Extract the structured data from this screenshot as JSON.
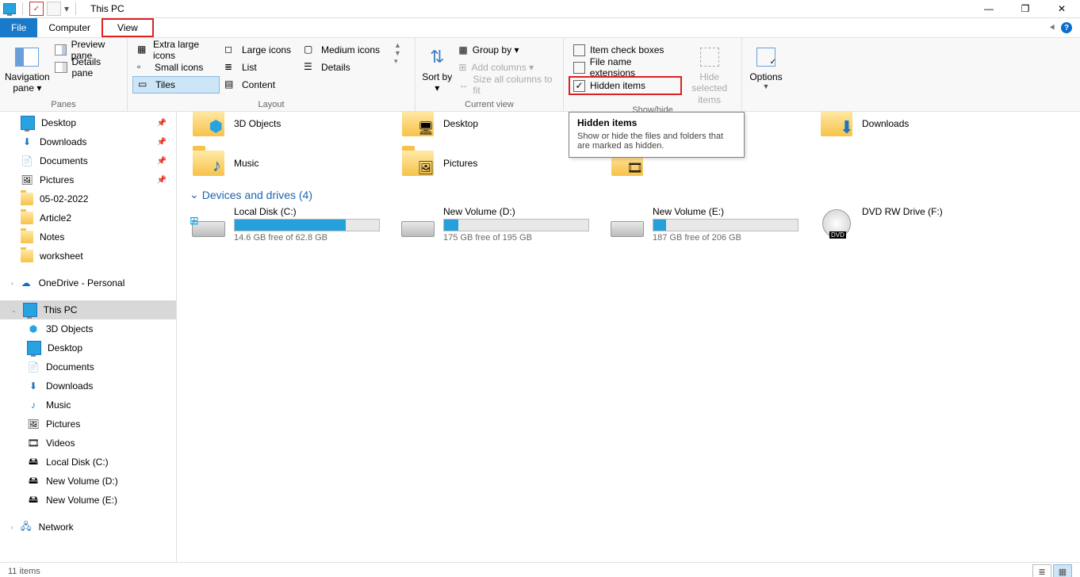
{
  "window": {
    "title": "This PC"
  },
  "window_controls": {
    "min": "—",
    "max": "❐",
    "close": "✕"
  },
  "tabs": {
    "file": "File",
    "computer": "Computer",
    "view": "View"
  },
  "ribbon": {
    "panes": {
      "nav": "Navigation pane ▾",
      "preview": "Preview pane",
      "details": "Details pane",
      "group": "Panes"
    },
    "layout": {
      "xl": "Extra large icons",
      "lg": "Large icons",
      "md": "Medium icons",
      "sm": "Small icons",
      "list": "List",
      "details": "Details",
      "tiles": "Tiles",
      "content": "Content",
      "group": "Layout"
    },
    "currentview": {
      "sort": "Sort by ▾",
      "groupby": "Group by ▾",
      "addcols": "Add columns ▾",
      "sizecols": "Size all columns to fit",
      "group": "Current view"
    },
    "showhide": {
      "itemcheck": "Item check boxes",
      "fne": "File name extensions",
      "hidden": "Hidden items",
      "hidesel": "Hide selected items",
      "group": "Show/hide"
    },
    "options": {
      "label": "Options",
      "group": ""
    }
  },
  "tooltip": {
    "title": "Hidden items",
    "body": "Show or hide the files and folders that are marked as hidden."
  },
  "tree": {
    "desktop": "Desktop",
    "downloads": "Downloads",
    "documents": "Documents",
    "pictures": "Pictures",
    "f1": "05-02-2022",
    "f2": "Article2",
    "f3": "Notes",
    "f4": "worksheet",
    "onedrive": "OneDrive - Personal",
    "thispc": "This PC",
    "obj3d": "3D Objects",
    "desktop2": "Desktop",
    "documents2": "Documents",
    "downloads2": "Downloads",
    "music": "Music",
    "pictures2": "Pictures",
    "videos": "Videos",
    "driveC": "Local Disk (C:)",
    "driveD": "New Volume (D:)",
    "driveE": "New Volume (E:)",
    "network": "Network"
  },
  "main": {
    "folders": {
      "obj3d": "3D Objects",
      "desktop": "Desktop",
      "downloads": "Downloads",
      "music": "Music",
      "pictures": "Pictures"
    },
    "section_drives": "Devices and drives (4)",
    "drives": {
      "c": {
        "name": "Local Disk (C:)",
        "free": "14.6 GB free of 62.8 GB",
        "fill": 77
      },
      "d": {
        "name": "New Volume (D:)",
        "free": "175 GB free of 195 GB",
        "fill": 10
      },
      "e": {
        "name": "New Volume (E:)",
        "free": "187 GB free of 206 GB",
        "fill": 9
      },
      "f": {
        "name": "DVD RW Drive (F:)"
      }
    }
  },
  "status": {
    "count": "11 items"
  }
}
